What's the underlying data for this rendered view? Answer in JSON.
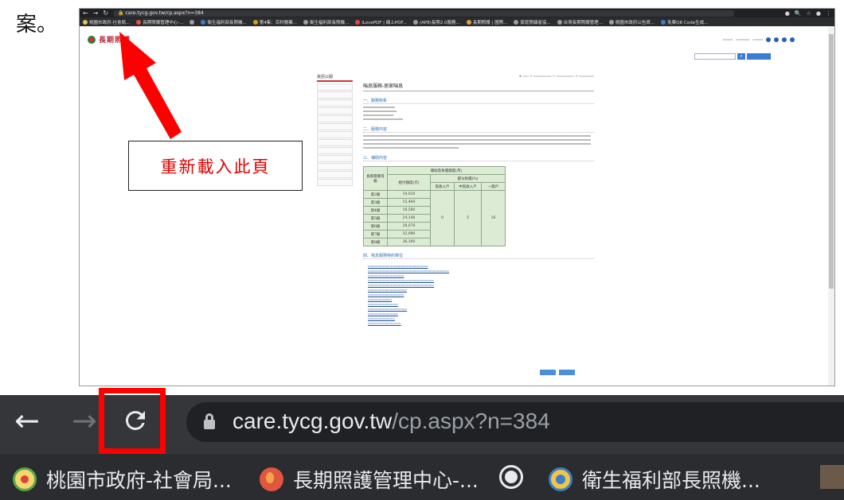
{
  "doc_caption": "案。",
  "annotation_note": "重新載入此頁",
  "colors": {
    "annotation": "#ff0000",
    "chrome_dark": "#202124",
    "toolbar": "#35363a"
  },
  "small_browser": {
    "url": "care.tycg.gov.tw/cp.aspx?n=384",
    "nav_icons": [
      "back-icon",
      "forward-icon",
      "reload-icon"
    ],
    "bookmarks": [
      "桃園市政府-社會局...",
      "長期照護管理中心-...",
      "衛生福利部長照機...",
      "第4集：百科醫藥...",
      "衛生福利部長照機...",
      "iLovePDF | 線上PDF...",
      "(AP8)長照2.0服務...",
      "長期照護 | 國際...",
      "家庭照顧者協...",
      "台灣長期照護管理...",
      "桃園市政府公告資...",
      "免費QR Code生成..."
    ],
    "site": {
      "logo": "長期照護",
      "sidebar_title": "資訊公開",
      "sidebar_items": [
        "",
        "",
        "",
        "",
        "",
        "",
        "",
        "",
        "",
        "",
        "",
        "",
        ""
      ],
      "content_title": "喘息服務-居家喘息",
      "sections": [
        "一、服務對象",
        "二、服務內容",
        "三、補助內容",
        "四、喘息服務特約單位"
      ],
      "table": {
        "header_main": "補助及負擔額度(月)",
        "col_level": "長照需要等級",
        "col_amount": "給付額度(元)",
        "col_share": "部分負擔(%)",
        "share_cols": [
          "低收入戶",
          "中低收入戶",
          "一般戶"
        ],
        "rows": [
          [
            "第2級",
            "10,020"
          ],
          [
            "第3級",
            "15,460"
          ],
          [
            "第4級",
            "18,580"
          ],
          [
            "第5級",
            "24,100"
          ],
          [
            "第6級",
            "28,070"
          ],
          [
            "第7級",
            "32,090"
          ],
          [
            "第8級",
            "36,180"
          ]
        ],
        "share_values": [
          "0",
          "5",
          "16"
        ]
      }
    }
  },
  "zoomed_browser": {
    "url_host": "care.tycg.gov.tw",
    "url_path": "/cp.aspx?n=384",
    "bookmarks": [
      {
        "label": "桃園市政府-社會局...",
        "icon": "tycg-emblem-icon"
      },
      {
        "label": "長期照護管理中心-...",
        "icon": "ltc-center-icon"
      },
      {
        "label": "",
        "icon": "globe-icon"
      },
      {
        "label": "衛生福利部長照機...",
        "icon": "mohw-icon"
      },
      {
        "label": "",
        "icon": "image-icon"
      }
    ]
  }
}
